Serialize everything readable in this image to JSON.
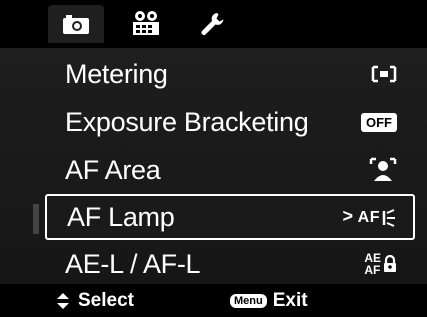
{
  "tabs": [
    {
      "icon": "camera-icon",
      "active": true
    },
    {
      "icon": "video-camera-icon",
      "active": false
    },
    {
      "icon": "wrench-icon",
      "active": false
    }
  ],
  "menu": {
    "items": [
      {
        "label": "Metering",
        "value_icon": "spot-metering-icon"
      },
      {
        "label": "Exposure Bracketing",
        "value": "OFF"
      },
      {
        "label": "AF Area",
        "value_icon": "face-af-area-icon"
      },
      {
        "label": "AF Lamp",
        "value": "AF",
        "value_icon": "af-lamp-icon",
        "arrow": ">"
      },
      {
        "label": "AE-L / AF-L",
        "value_top": "AE",
        "value_bottom": "AF",
        "value_icon": "lock-icon"
      }
    ],
    "selected_index": 3
  },
  "footer": {
    "select_label": "Select",
    "menu_badge": "Menu",
    "exit_label": "Exit"
  }
}
